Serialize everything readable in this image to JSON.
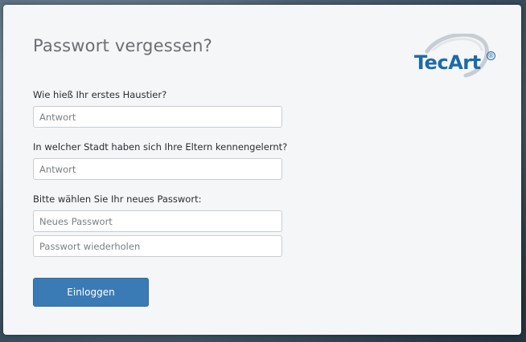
{
  "page": {
    "title": "Passwort vergessen?",
    "logo": {
      "text": "TecArt",
      "registered": "®"
    }
  },
  "form": {
    "question1": {
      "label": "Wie hieß Ihr erstes Haustier?",
      "placeholder": "Antwort",
      "value": ""
    },
    "question2": {
      "label": "In welcher Stadt haben sich Ihre Eltern kennengelernt?",
      "placeholder": "Antwort",
      "value": ""
    },
    "new_password": {
      "label": "Bitte wählen Sie Ihr neues Passwort:",
      "placeholder": "Neues Passwort",
      "repeat_placeholder": "Passwort wiederholen"
    },
    "submit_label": "Einloggen"
  },
  "colors": {
    "accent": "#3a7bb6",
    "logo": "#1d6aa8",
    "card": "#f4f6f8"
  }
}
